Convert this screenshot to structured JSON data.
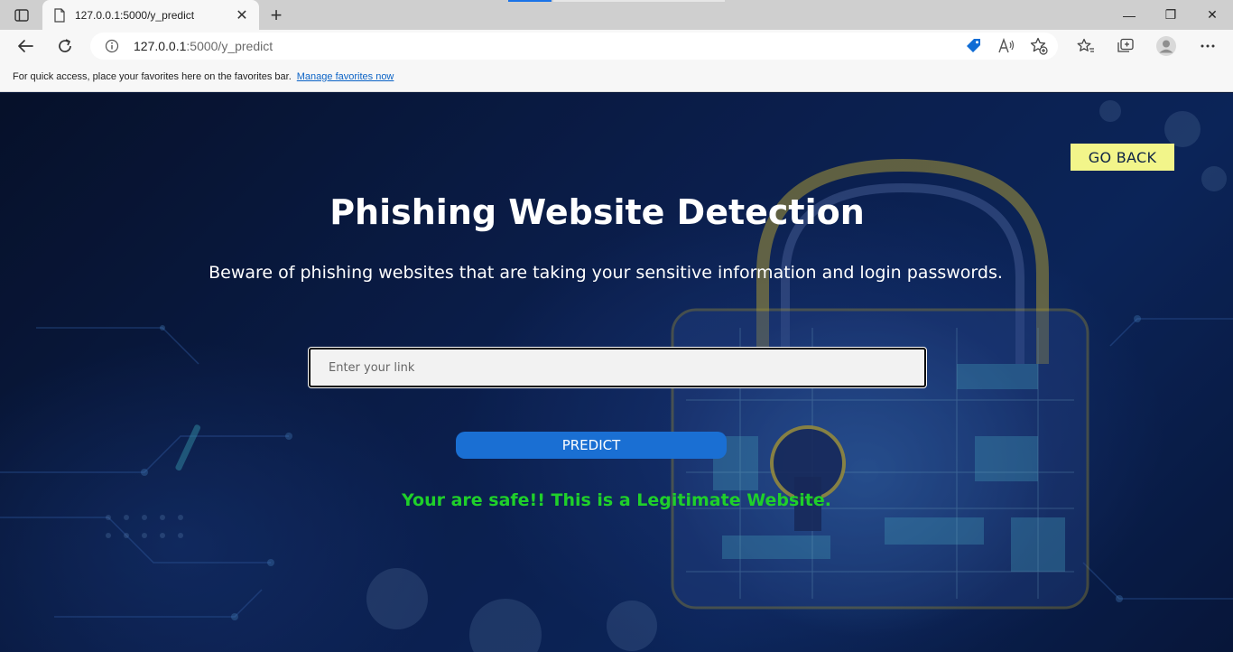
{
  "browser": {
    "tab": {
      "title": "127.0.0.1:5000/y_predict",
      "close_glyph": "✕"
    },
    "new_tab_glyph": "+",
    "window_controls": {
      "minimize": "—",
      "restore": "❐",
      "close": "✕"
    },
    "address": {
      "host": "127.0.0.1",
      "path": ":5000/y_predict"
    },
    "favorites_bar": {
      "message": "For quick access, place your favorites here on the favorites bar.",
      "link": "Manage favorites now"
    },
    "accent_color": "#1a73e8"
  },
  "page": {
    "go_back_label": "GO BACK",
    "title": "Phishing Website Detection",
    "subtitle": "Beware of phishing websites that are taking your sensitive information and login passwords.",
    "link_input": {
      "placeholder": "Enter your link",
      "value": ""
    },
    "predict_label": "PREDICT",
    "result": "Your are safe!! This is a Legitimate Website.",
    "colors": {
      "go_back_bg": "#f2f58a",
      "predict_bg": "#1a6fd3",
      "result_text": "#1fd02a",
      "background": "#0c2256"
    }
  }
}
